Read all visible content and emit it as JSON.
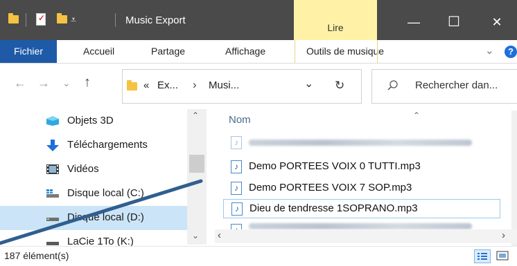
{
  "window": {
    "title": "Music Export"
  },
  "titlebar": {
    "icons": [
      "folder-icon",
      "properties-icon",
      "new-folder-icon",
      "quick-access-dropdown-icon"
    ],
    "contextual_tab": "Lire",
    "buttons": {
      "minimize": "—",
      "maximize": "☐",
      "close": "✕"
    }
  },
  "ribbon": {
    "tabs": [
      "Fichier",
      "Accueil",
      "Partage",
      "Affichage",
      "Outils de musique"
    ],
    "expand_icon": "chevron-down-icon",
    "help_icon": "?"
  },
  "address": {
    "back": "←",
    "forward": "→",
    "recent": "⌄",
    "up": "↑",
    "overflow": "«",
    "crumb1": "Ex...",
    "arrow": "›",
    "crumb2": "Musi...",
    "dropdown": "⌄",
    "refresh": "↻",
    "search_placeholder": "Rechercher dan..."
  },
  "nav_pane": {
    "items": [
      {
        "label": "Objets 3D",
        "icon": "3d-objects-icon"
      },
      {
        "label": "Téléchargements",
        "icon": "downloads-icon"
      },
      {
        "label": "Vidéos",
        "icon": "videos-icon"
      },
      {
        "label": "Disque local (C:)",
        "icon": "drive-c-icon"
      },
      {
        "label": "Disque local (D:)",
        "icon": "drive-d-icon",
        "selected": true
      },
      {
        "label": "LaCie 1To (K:)",
        "icon": "external-drive-icon"
      }
    ]
  },
  "file_list": {
    "column_name": "Nom",
    "files": [
      {
        "name": "",
        "blurred": true
      },
      {
        "name": "Demo PORTEES VOIX 0 TUTTI.mp3"
      },
      {
        "name": "Demo PORTEES VOIX 7 SOP.mp3"
      },
      {
        "name": "Dieu de tendresse 1SOPRANO.mp3",
        "selected": true
      },
      {
        "name": "",
        "blurred": true
      }
    ]
  },
  "status": {
    "count": "187 élément(s)"
  },
  "colors": {
    "titlebar": "#4a4a4a",
    "fichier": "#1e5aa8",
    "contextual": "#fff2a6",
    "selection": "#cce4f7",
    "annotation_line": "#2f5f8f"
  }
}
